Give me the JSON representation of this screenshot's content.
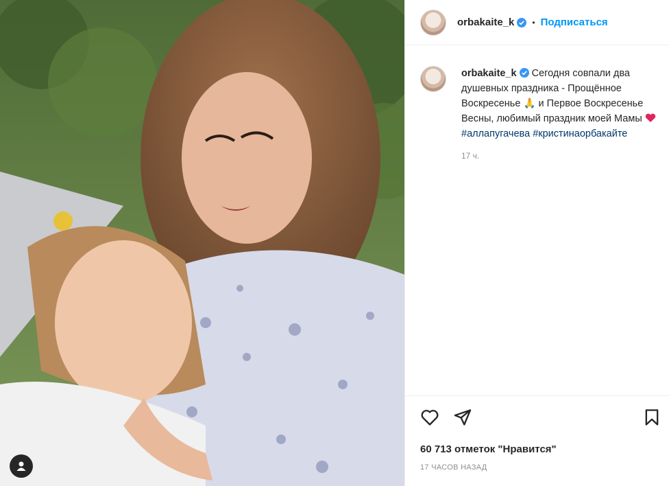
{
  "post": {
    "username": "orbakaite_k",
    "separator": "•",
    "follow_label": "Подписаться",
    "caption": {
      "username": "orbakaite_k",
      "line1": "Сегодня совпали два душевных праздника - Прощённое Воскресенье",
      "emoji1": "🙏",
      "line2": " и Первое Воскресенье Весны, любимый праздник моей Мамы",
      "hashtag1": "#аллапугачева",
      "hashtag2": "#кристинаорбакайте"
    },
    "relative_time": "17 ч.",
    "likes_text": "60 713 отметок \"Нравится\"",
    "timestamp": "17 ЧАСОВ НАЗАД"
  },
  "icons": [
    "verified-icon",
    "heart-icon",
    "share-icon",
    "bookmark-icon",
    "tagged-user-icon"
  ],
  "colors": {
    "accent": "#0095f6",
    "verified": "#3897f0",
    "heart": "#e0245e",
    "hashtag": "#00376b"
  }
}
